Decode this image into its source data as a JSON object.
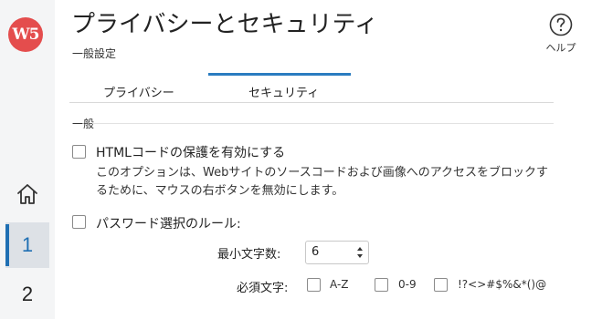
{
  "rail": {
    "logo_text": "W5",
    "items": [
      {
        "label": "1",
        "active": true
      },
      {
        "label": "2",
        "active": false
      }
    ],
    "accent": "#1f6fb3"
  },
  "header": {
    "title": "プライバシーとセキュリティ",
    "subtitle": "一般設定",
    "help_label": "ヘルプ"
  },
  "tabs": [
    {
      "label": "プライバシー",
      "active": false
    },
    {
      "label": "セキュリティ",
      "active": true
    }
  ],
  "section": {
    "title": "一般",
    "html_protect": {
      "label": "HTMLコードの保護を有効にする",
      "checked": false,
      "description": "このオプションは、Webサイトのソースコードおよび画像へのアクセスをブロックするために、マウスの右ボタンを無効にします。"
    },
    "password_rule": {
      "label": "パスワード選択のルール:",
      "checked": false,
      "min_chars_label": "最小文字数:",
      "min_chars_value": "6",
      "required_label": "必須文字:",
      "required_options": [
        {
          "label": "A-Z",
          "checked": false
        },
        {
          "label": "0-9",
          "checked": false
        },
        {
          "label": "!?<>#$%&*()@",
          "checked": false
        }
      ]
    }
  }
}
